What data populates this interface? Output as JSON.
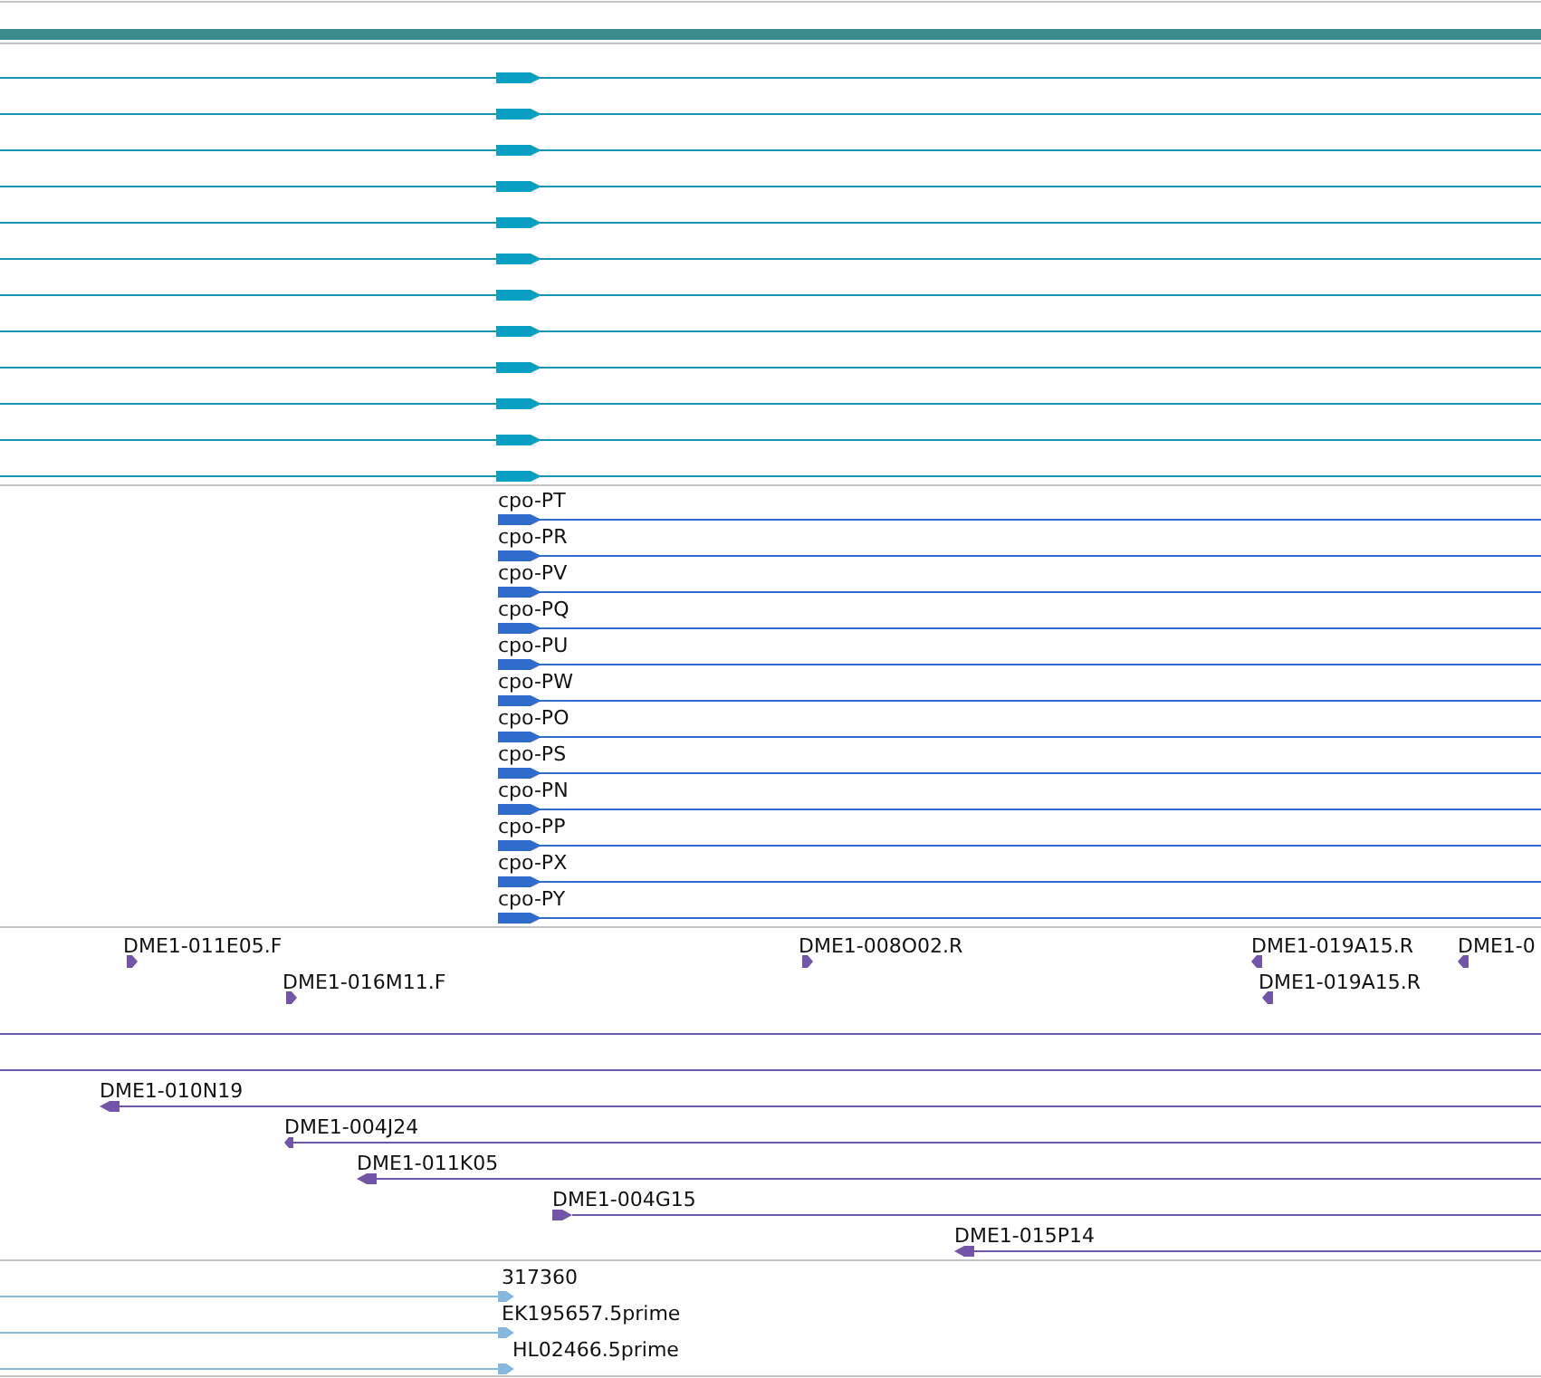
{
  "gene_track": {
    "transcripts": [
      {
        "forward": true
      },
      {
        "forward": true
      },
      {
        "forward": true
      },
      {
        "forward": true
      },
      {
        "forward": true
      },
      {
        "forward": true
      },
      {
        "forward": true
      },
      {
        "forward": true
      },
      {
        "forward": true
      },
      {
        "forward": true
      },
      {
        "forward": true
      },
      {
        "forward": true
      }
    ]
  },
  "protein_track": {
    "features": [
      {
        "label": "cpo-PT",
        "forward": true
      },
      {
        "label": "cpo-PR",
        "forward": true
      },
      {
        "label": "cpo-PV",
        "forward": true
      },
      {
        "label": "cpo-PQ",
        "forward": true
      },
      {
        "label": "cpo-PU",
        "forward": true
      },
      {
        "label": "cpo-PW",
        "forward": true
      },
      {
        "label": "cpo-PO",
        "forward": true
      },
      {
        "label": "cpo-PS",
        "forward": true
      },
      {
        "label": "cpo-PN",
        "forward": true
      },
      {
        "label": "cpo-PP",
        "forward": true
      },
      {
        "label": "cpo-PX",
        "forward": true
      },
      {
        "label": "cpo-PY",
        "forward": true
      }
    ]
  },
  "clone_track": {
    "end_reads": [
      {
        "label": "DME1-011E05.F",
        "forward": true
      },
      {
        "label": "DME1-008O02.R",
        "forward": true
      },
      {
        "label": "DME1-019A15.R",
        "forward": false
      },
      {
        "label": "DME1-0",
        "forward": false
      },
      {
        "label": "DME1-016M11.F",
        "forward": true
      },
      {
        "label": "DME1-019A15.R",
        "forward": false
      }
    ],
    "clones": [
      {
        "label": "DME1-010N19",
        "forward": false
      },
      {
        "label": "DME1-004J24",
        "forward": false
      },
      {
        "label": "DME1-011K05",
        "forward": false
      },
      {
        "label": "DME1-004G15",
        "forward": true
      },
      {
        "label": "DME1-015P14",
        "forward": false
      }
    ]
  },
  "est_track": {
    "features": [
      {
        "label": "317360",
        "forward": true
      },
      {
        "label": "EK195657.5prime",
        "forward": true
      },
      {
        "label": "HL02466.5prime",
        "forward": true
      }
    ]
  }
}
